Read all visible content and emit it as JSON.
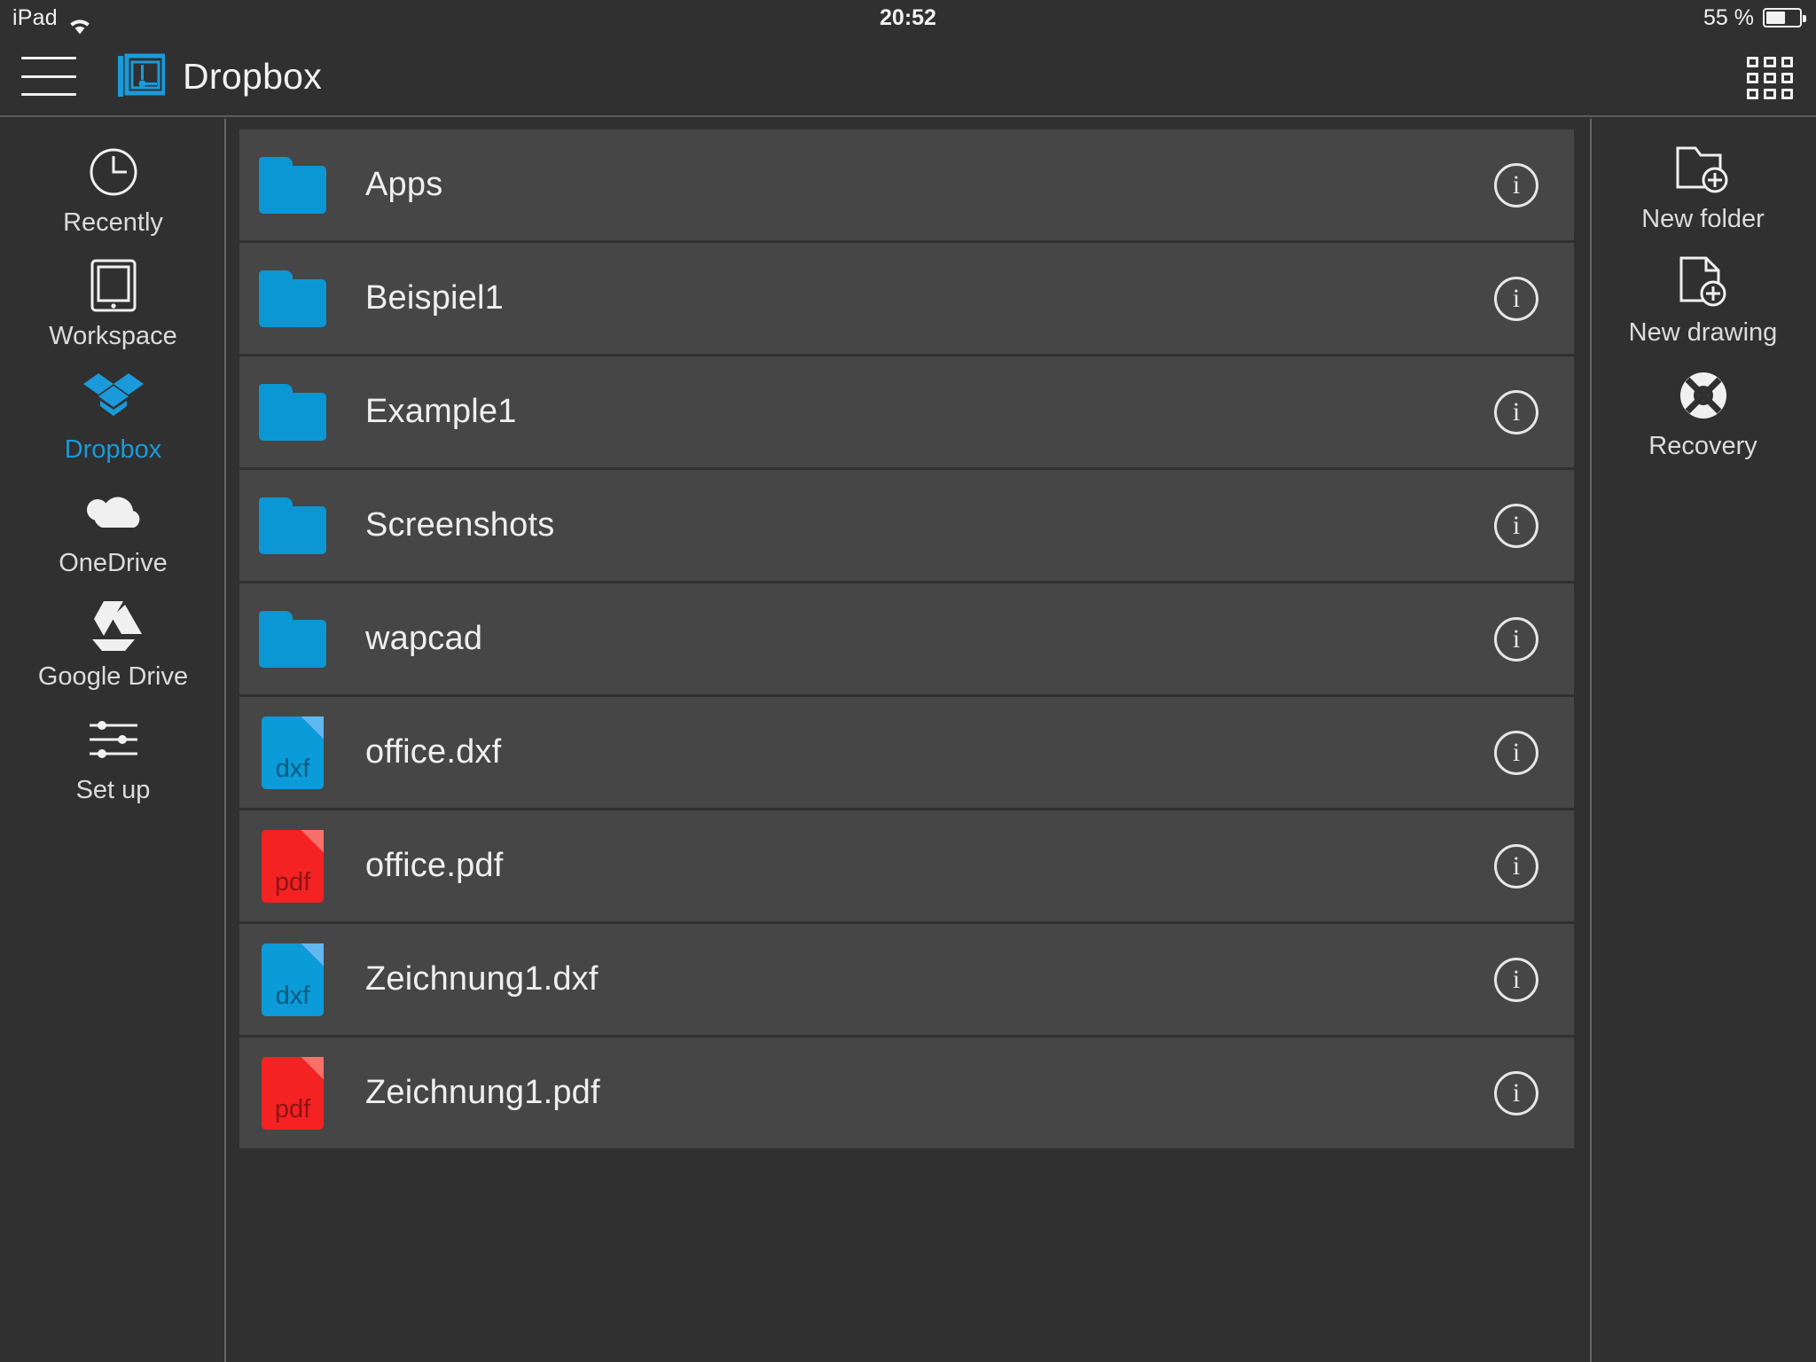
{
  "status_bar": {
    "device": "iPad",
    "wifi_icon": "wifi-icon",
    "time": "20:52",
    "battery_percent": "55 %",
    "battery_icon": "battery-icon"
  },
  "header": {
    "menu_icon": "hamburger-icon",
    "logo_icon": "cad-app-logo-icon",
    "title": "Dropbox",
    "grid_view_icon": "grid-view-icon"
  },
  "left_sidebar": {
    "items": [
      {
        "label": "Recently",
        "icon": "clock-icon",
        "active": false
      },
      {
        "label": "Workspace",
        "icon": "tablet-icon",
        "active": false
      },
      {
        "label": "Dropbox",
        "icon": "dropbox-icon",
        "active": true
      },
      {
        "label": "OneDrive",
        "icon": "onedrive-cloud-icon",
        "active": false
      },
      {
        "label": "Google Drive",
        "icon": "google-drive-icon",
        "active": false
      },
      {
        "label": "Set up",
        "icon": "sliders-icon",
        "active": false
      }
    ]
  },
  "right_sidebar": {
    "items": [
      {
        "label": "New folder",
        "icon": "new-folder-icon"
      },
      {
        "label": "New drawing",
        "icon": "new-drawing-icon"
      },
      {
        "label": "Recovery",
        "icon": "lifebuoy-icon"
      }
    ]
  },
  "file_list": {
    "info_label": "i",
    "rows": [
      {
        "name": "Apps",
        "kind": "folder",
        "ext": ""
      },
      {
        "name": "Beispiel1",
        "kind": "folder",
        "ext": ""
      },
      {
        "name": "Example1",
        "kind": "folder",
        "ext": ""
      },
      {
        "name": "Screenshots",
        "kind": "folder",
        "ext": ""
      },
      {
        "name": "wapcad",
        "kind": "folder",
        "ext": ""
      },
      {
        "name": "office.dxf",
        "kind": "file",
        "ext": "dxf"
      },
      {
        "name": "office.pdf",
        "kind": "file",
        "ext": "pdf"
      },
      {
        "name": "Zeichnung1.dxf",
        "kind": "file",
        "ext": "dxf"
      },
      {
        "name": "Zeichnung1.pdf",
        "kind": "file",
        "ext": "pdf"
      }
    ]
  },
  "colors": {
    "background": "#303030",
    "row": "#464646",
    "accent_blue": "#1a9ada",
    "folder_blue": "#0b97d4",
    "dxf_blue": "#0b9bd8",
    "pdf_red": "#f42222",
    "text": "#efefef",
    "divider": "#676767"
  }
}
